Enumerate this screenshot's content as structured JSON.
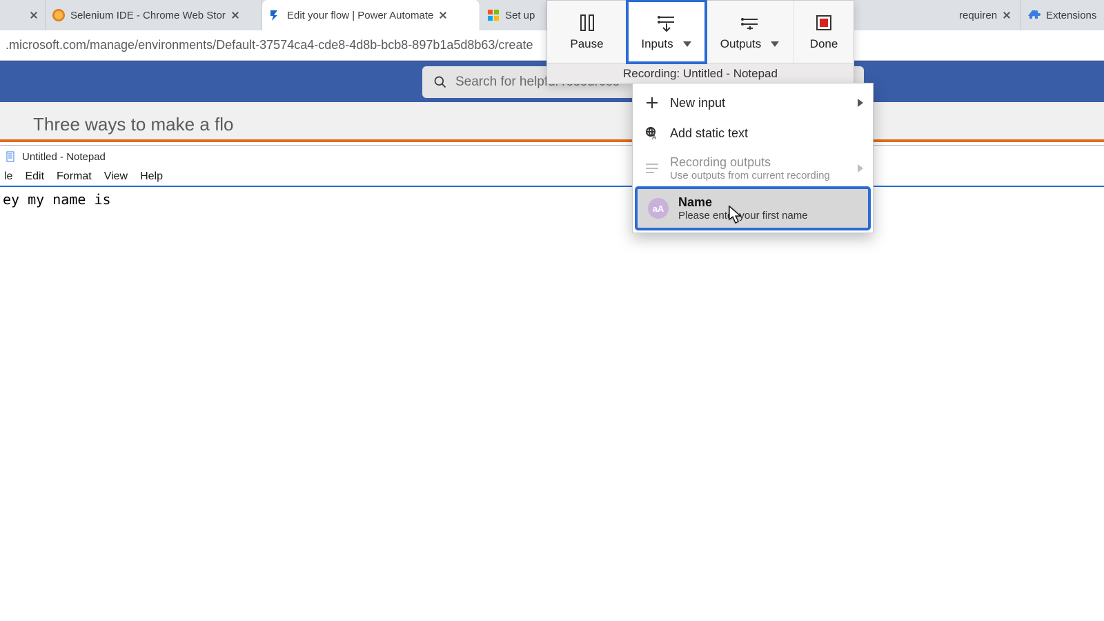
{
  "tabs": {
    "t1": {
      "title": "Selenium IDE - Chrome Web Stor"
    },
    "t2": {
      "title": "Edit your flow | Power Automate"
    },
    "t3": {
      "title": "Set up"
    },
    "t4": {
      "title": "requiren"
    },
    "t5": {
      "title": "Extensions"
    }
  },
  "address": {
    "url": ".microsoft.com/manage/environments/Default-37574ca4-cde8-4d8b-bcb8-897b1a5d8b63/create"
  },
  "page": {
    "search_placeholder": "Search for helpful resources",
    "heading": "Three ways to make a flo"
  },
  "notepad": {
    "title": "Untitled - Notepad",
    "menu": {
      "file": "le",
      "edit": "Edit",
      "format": "Format",
      "view": "View",
      "help": "Help"
    },
    "body": "ey my name is"
  },
  "recorder": {
    "pause": "Pause",
    "inputs": "Inputs",
    "outputs": "Outputs",
    "done": "Done",
    "subtitle": "Recording: Untitled - Notepad"
  },
  "inputs_menu": {
    "new_input": "New input",
    "add_static": "Add static text",
    "rec_out_title": "Recording outputs",
    "rec_out_sub": "Use outputs from current recording",
    "name_badge": "aA",
    "name_title": "Name",
    "name_sub": "Please enter your first name"
  }
}
